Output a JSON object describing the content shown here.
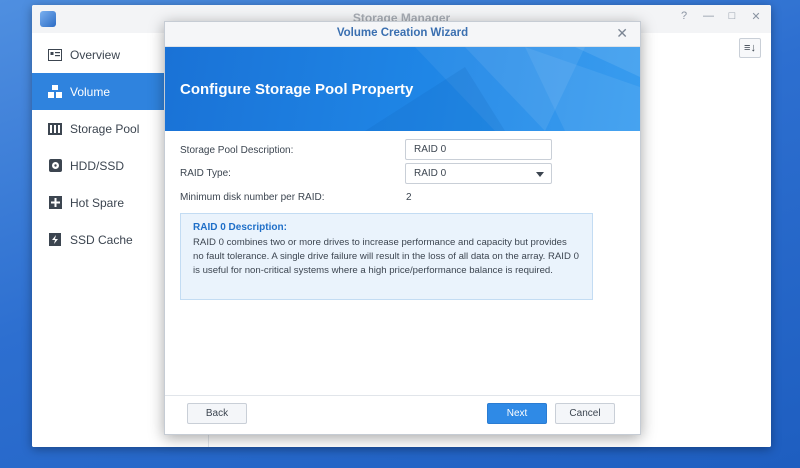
{
  "app": {
    "title": "Storage Manager",
    "window_controls": [
      "?",
      "—",
      "□",
      "✕"
    ],
    "sort_icon": "≡↓"
  },
  "sidebar": {
    "items": [
      {
        "label": "Overview",
        "icon": "overview-icon",
        "active": false
      },
      {
        "label": "Volume",
        "icon": "volume-icon",
        "active": true
      },
      {
        "label": "Storage Pool",
        "icon": "storage-pool-icon",
        "active": false
      },
      {
        "label": "HDD/SSD",
        "icon": "hdd-icon",
        "active": false
      },
      {
        "label": "Hot Spare",
        "icon": "hot-spare-icon",
        "active": false
      },
      {
        "label": "SSD Cache",
        "icon": "ssd-cache-icon",
        "active": false
      }
    ]
  },
  "wizard": {
    "title": "Volume Creation Wizard",
    "heading": "Configure Storage Pool Property",
    "close_icon": "✕",
    "form": {
      "description_label": "Storage Pool Description:",
      "description_value": "RAID 0",
      "raid_type_label": "RAID Type:",
      "raid_type_value": "RAID 0",
      "min_disk_label": "Minimum disk number per RAID:",
      "min_disk_value": "2"
    },
    "info": {
      "title": "RAID 0 Description:",
      "text": "RAID 0 combines two or more drives to increase performance and capacity but provides no fault tolerance. A single drive failure will result in the loss of all data on the array. RAID 0 is useful for non-critical systems where a high price/performance balance is required."
    },
    "buttons": {
      "back": "Back",
      "next": "Next",
      "cancel": "Cancel"
    }
  },
  "colors": {
    "accent": "#2f83de",
    "banner": "#1f86e6",
    "desktop": "#2d6fd0"
  }
}
